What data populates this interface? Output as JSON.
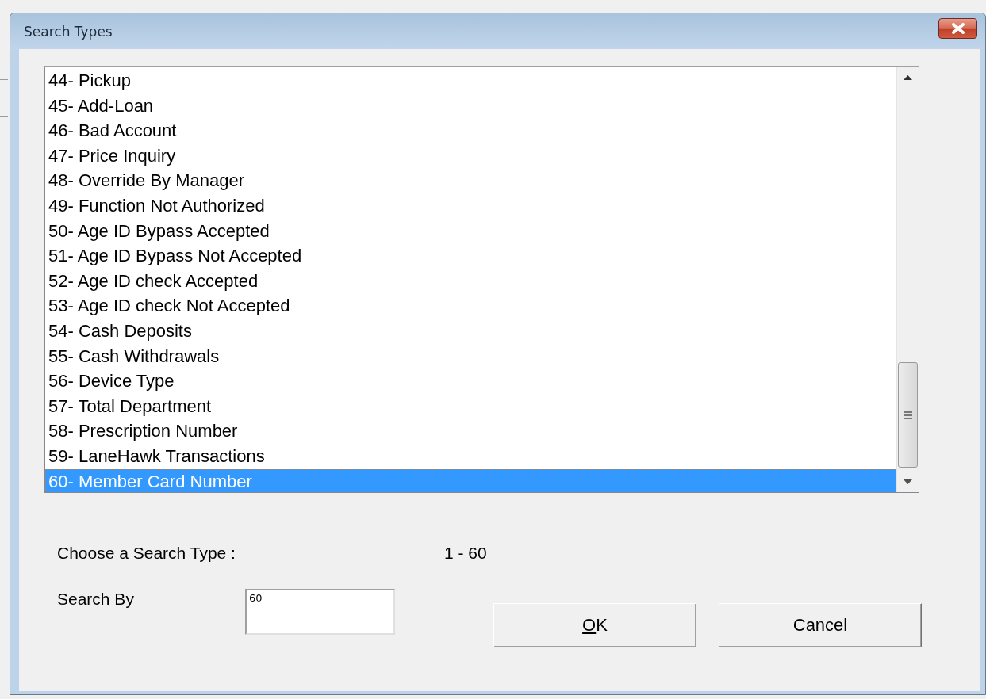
{
  "window": {
    "title": "Search Types"
  },
  "list": {
    "items": [
      {
        "label": "44- Pickup",
        "selected": false
      },
      {
        "label": "45- Add-Loan",
        "selected": false
      },
      {
        "label": "46- Bad Account",
        "selected": false
      },
      {
        "label": "47- Price Inquiry",
        "selected": false
      },
      {
        "label": "48- Override By Manager",
        "selected": false
      },
      {
        "label": "49- Function Not Authorized",
        "selected": false
      },
      {
        "label": "50- Age ID Bypass Accepted",
        "selected": false
      },
      {
        "label": "51- Age ID Bypass Not Accepted",
        "selected": false
      },
      {
        "label": "52- Age ID check Accepted",
        "selected": false
      },
      {
        "label": "53- Age ID check Not Accepted",
        "selected": false
      },
      {
        "label": "54- Cash Deposits",
        "selected": false
      },
      {
        "label": "55- Cash Withdrawals",
        "selected": false
      },
      {
        "label": "56- Device Type",
        "selected": false
      },
      {
        "label": "57- Total Department",
        "selected": false
      },
      {
        "label": "58- Prescription Number",
        "selected": false
      },
      {
        "label": "59- LaneHawk Transactions",
        "selected": false
      },
      {
        "label": "60- Member Card Number",
        "selected": true
      }
    ]
  },
  "choose": {
    "label": "Choose a Search Type :",
    "range": "1 - 60"
  },
  "search_by": {
    "label": "Search By",
    "value": "60"
  },
  "buttons": [
    {
      "label": "OK",
      "mnemonic": true
    },
    {
      "label": "Cancel",
      "mnemonic": false
    }
  ]
}
